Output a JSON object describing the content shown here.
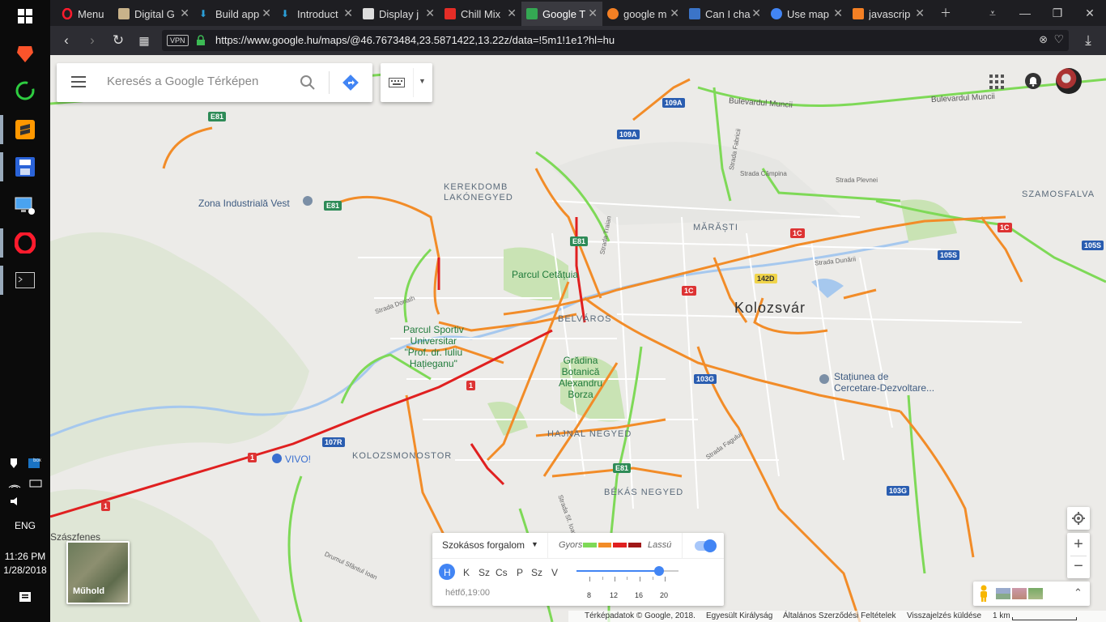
{
  "taskbar": {
    "tray": {
      "language": "ENG",
      "time": "11:26 PM",
      "date": "1/28/2018",
      "box_label": "box"
    }
  },
  "browser": {
    "menu_label": "Menu",
    "tabs": [
      {
        "label": "Digital G",
        "color": "#c8b28a"
      },
      {
        "label": "Build app",
        "color": "#2b9fd8"
      },
      {
        "label": "Introduct",
        "color": "#2b9fd8"
      },
      {
        "label": "Display j",
        "color": "#dddddd"
      },
      {
        "label": "Chill Mix",
        "color": "#e52d27"
      },
      {
        "label": "Google T",
        "color": "#34a853",
        "active": true
      },
      {
        "label": "google m",
        "color": "#f48024"
      },
      {
        "label": "Can I cha",
        "color": "#3b74c8"
      },
      {
        "label": "Use map",
        "color": "#4285f4"
      },
      {
        "label": "javascrip",
        "color": "#f48024"
      }
    ],
    "vpn_label": "VPN",
    "url": "https://www.google.hu/maps/@46.7673484,23.5871422,13.22z/data=!5m1!1e1?hl=hu"
  },
  "map": {
    "search": {
      "placeholder": "Keresés a Google Térképen"
    },
    "districts": {
      "kerekdomb": "KEREKDOMB",
      "lakonegyed": "LAKÓNEGYED",
      "marasti": "MĂRĂȘTI",
      "belvaros": "BELVÁROS",
      "hajnal": "HAJNAL NEGYED",
      "kolozsmonostor": "KOLOZSMONOSTOR",
      "bekas": "BÉKÁS NEGYED",
      "szamosfalva": "SZAMOSFALVA"
    },
    "city": "Kolozsvár",
    "places": {
      "zona": "Zona Industrială Vest",
      "parcul_cetatuia": "Parcul Cetățuia",
      "parcul_sportiv": "Parcul Sportiv\nUniversitar\n\"Prof. dr. Iuliu\nHațieganu\"",
      "gradina": "Grădina\nBotanică\nAlexandru\nBorza",
      "statiunea": "Stațiunea de\nCercetare-Dezvoltare...",
      "vivo": "VIVO!",
      "szaszfenes": "Szászfenes"
    },
    "streets": {
      "bulevardul": "Bulevardul Muncii",
      "bulevardul2": "Bulevardul Muncii",
      "campina": "Strada Câmpina",
      "plevnei": "Strada Plevnei",
      "dunarii": "Strada Dunării",
      "donath": "Strada Donath",
      "faget": "Strada Fagului",
      "traian": "Strada Traian",
      "drumul": "Drumul Sfântul Ioan",
      "strada_s": "Strada Sf. Ioan",
      "strada_f": "Strada Fabricii"
    },
    "shields": {
      "e81a": "E81",
      "e81b": "E81",
      "e81c": "E81",
      "e81d": "E81",
      "r109a": "109A",
      "r109a2": "109A",
      "r1c": "1C",
      "r1c2": "1C",
      "r1c3": "1C",
      "r142d": "142D",
      "r105s": "105S",
      "r105s2": "105S",
      "r103g": "103G",
      "r103g2": "103G",
      "r107r": "107R",
      "r1": "1",
      "r1b": "1",
      "r1c4": "1"
    },
    "satellite_label": "Műhold",
    "traffic": {
      "mode": "Szokásos forgalom",
      "fast": "Gyors",
      "slow": "Lassú",
      "days": [
        "H",
        "K",
        "Sz",
        "Cs",
        "P",
        "Sz",
        "V"
      ],
      "time": "hétfő,19:00",
      "ticks": [
        "8",
        "12",
        "16",
        "20"
      ],
      "slider_value": 0.81
    },
    "footer": {
      "data": "Térképadatok © Google, 2018.",
      "kingdom": "Egyesült Királyság",
      "terms": "Általános Szerződési Feltételek",
      "feedback": "Visszajelzés küldése",
      "scale": "1 km"
    },
    "colors": {
      "fast": "#7ed957",
      "medium": "#f28c28",
      "slow": "#e02020",
      "very_slow": "#a01818"
    }
  }
}
